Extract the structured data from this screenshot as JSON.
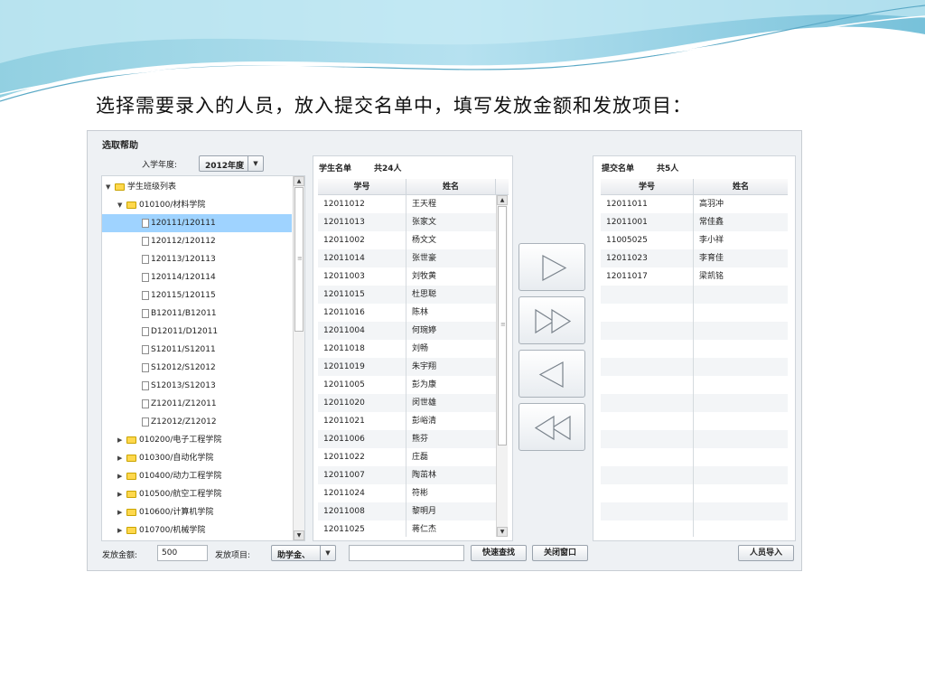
{
  "heading": "选择需要录入的人员，放入提交名单中，填写发放金额和发放项目：",
  "dialog": {
    "title": "选取帮助",
    "year_label": "入学年度:",
    "year_value": "2012年度",
    "tree": [
      {
        "label": "学生班级列表",
        "kind": "folder",
        "expanded": true,
        "level": 0
      },
      {
        "label": "010100/材料学院",
        "kind": "folder",
        "expanded": true,
        "level": 1
      },
      {
        "label": "120111/120111",
        "kind": "file",
        "level": 2,
        "selected": true
      },
      {
        "label": "120112/120112",
        "kind": "file",
        "level": 2
      },
      {
        "label": "120113/120113",
        "kind": "file",
        "level": 2
      },
      {
        "label": "120114/120114",
        "kind": "file",
        "level": 2
      },
      {
        "label": "120115/120115",
        "kind": "file",
        "level": 2
      },
      {
        "label": "B12011/B12011",
        "kind": "file",
        "level": 2
      },
      {
        "label": "D12011/D12011",
        "kind": "file",
        "level": 2
      },
      {
        "label": "S12011/S12011",
        "kind": "file",
        "level": 2
      },
      {
        "label": "S12012/S12012",
        "kind": "file",
        "level": 2
      },
      {
        "label": "S12013/S12013",
        "kind": "file",
        "level": 2
      },
      {
        "label": "Z12011/Z12011",
        "kind": "file",
        "level": 2
      },
      {
        "label": "Z12012/Z12012",
        "kind": "file",
        "level": 2
      },
      {
        "label": "010200/电子工程学院",
        "kind": "folder",
        "expanded": false,
        "level": 1
      },
      {
        "label": "010300/自动化学院",
        "kind": "folder",
        "expanded": false,
        "level": 1
      },
      {
        "label": "010400/动力工程学院",
        "kind": "folder",
        "expanded": false,
        "level": 1
      },
      {
        "label": "010500/航空工程学院",
        "kind": "folder",
        "expanded": false,
        "level": 1
      },
      {
        "label": "010600/计算机学院",
        "kind": "folder",
        "expanded": false,
        "level": 1
      },
      {
        "label": "010700/机械学院",
        "kind": "folder",
        "expanded": false,
        "level": 1
      }
    ],
    "students": {
      "title": "学生名单",
      "count": "共24人",
      "headers": [
        "学号",
        "姓名"
      ],
      "rows": [
        [
          "12011012",
          "王天程"
        ],
        [
          "12011013",
          "张家文"
        ],
        [
          "12011002",
          "杨文文"
        ],
        [
          "12011014",
          "张世豪"
        ],
        [
          "12011003",
          "刘牧黄"
        ],
        [
          "12011015",
          "杜思聪"
        ],
        [
          "12011016",
          "陈林"
        ],
        [
          "12011004",
          "何琬婷"
        ],
        [
          "12011018",
          "刘畅"
        ],
        [
          "12011019",
          "朱宇翔"
        ],
        [
          "12011005",
          "彭为康"
        ],
        [
          "12011020",
          "闵世雄"
        ],
        [
          "12011021",
          "彭峪清"
        ],
        [
          "12011006",
          "熊芬"
        ],
        [
          "12011022",
          "庄磊"
        ],
        [
          "12011007",
          "陶茁林"
        ],
        [
          "12011024",
          "符彬"
        ],
        [
          "12011008",
          "黎明月"
        ],
        [
          "12011025",
          "蒋仁杰"
        ]
      ]
    },
    "submitted": {
      "title": "提交名单",
      "count": "共5人",
      "headers": [
        "学号",
        "姓名"
      ],
      "rows": [
        [
          "12011011",
          "高羽冲"
        ],
        [
          "12011001",
          "常佳鑫"
        ],
        [
          "11005025",
          "李小祥"
        ],
        [
          "12011023",
          "李育佳"
        ],
        [
          "12011017",
          "梁凯铭"
        ]
      ]
    },
    "transfer_buttons": [
      "move-right-icon",
      "move-all-right-icon",
      "move-left-icon",
      "move-all-left-icon"
    ],
    "footer": {
      "amount_label": "发放金额:",
      "amount_value": "500",
      "item_label": "发放项目:",
      "item_value": "助学金、",
      "search_value": "",
      "quick_search": "快速查找",
      "close_window": "关闭窗口",
      "import_people": "人员导入"
    }
  }
}
